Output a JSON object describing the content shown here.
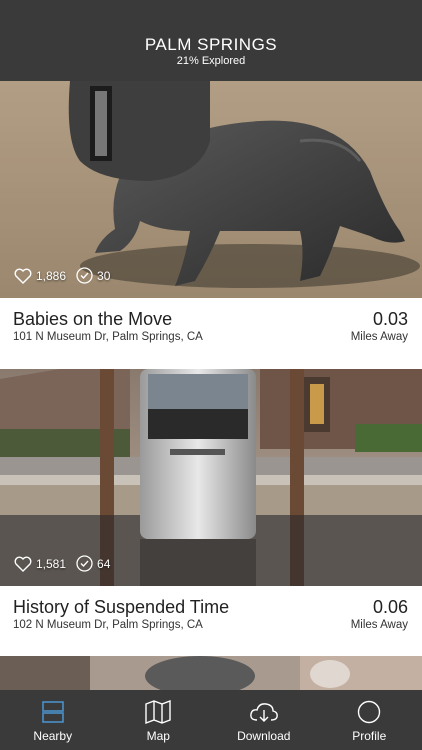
{
  "header": {
    "title": "PALM SPRINGS",
    "subtitle": "21% Explored"
  },
  "cards": [
    {
      "name": "Babies on the Move",
      "address": "101 N Museum Dr, Palm Springs, CA",
      "distance": "0.03",
      "distance_unit": "Miles Away",
      "likes": "1,886",
      "checkins": "30"
    },
    {
      "name": "History of Suspended Time",
      "address": "102 N Museum Dr, Palm Springs, CA",
      "distance": "0.06",
      "distance_unit": "Miles Away",
      "likes": "1,581",
      "checkins": "64"
    }
  ],
  "tabs": [
    {
      "label": "Nearby",
      "icon": "list-icon",
      "active": true
    },
    {
      "label": "Map",
      "icon": "map-icon",
      "active": false
    },
    {
      "label": "Download",
      "icon": "cloud-download-icon",
      "active": false
    },
    {
      "label": "Profile",
      "icon": "profile-circle-icon",
      "active": false
    }
  ],
  "colors": {
    "bar": "#3a3a3a",
    "active_tab_icon": "#4a90c8"
  }
}
